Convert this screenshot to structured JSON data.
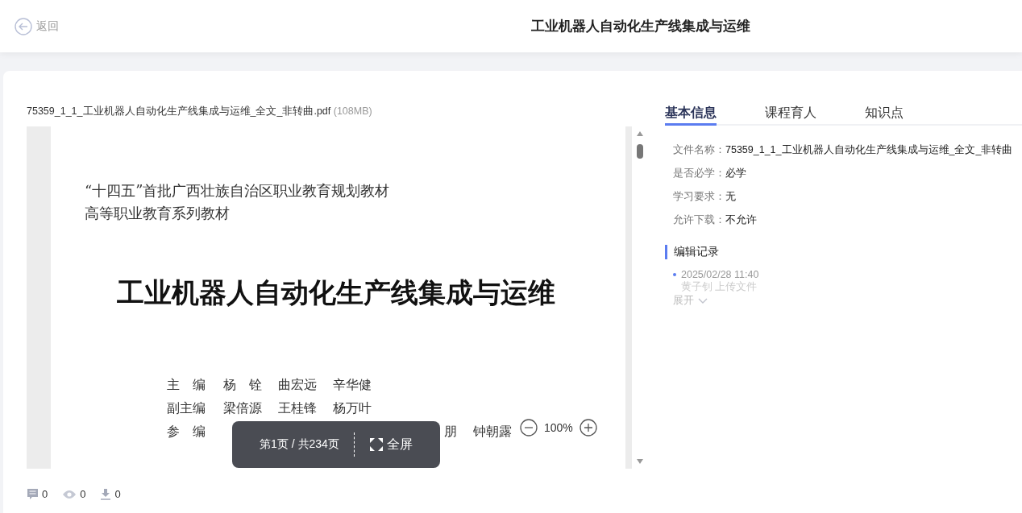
{
  "header": {
    "back_label": "返回",
    "title": "工业机器人自动化生产线集成与运维"
  },
  "file": {
    "name": "75359_1_1_工业机器人自动化生产线集成与运维_全文_非转曲.pdf",
    "size": "(108MB)"
  },
  "document_page": {
    "series_lines": [
      "“十四五”首批广西壮族自治区职业教育规划教材",
      "高等职业教育系列教材"
    ],
    "book_title": "工业机器人自动化生产线集成与运维",
    "credits": [
      {
        "role": "主　编",
        "names": [
          "杨　铨",
          "曲宏远",
          "辛华健"
        ]
      },
      {
        "role": "副主编",
        "names": [
          "梁倍源",
          "王桂锋",
          "杨万叶"
        ]
      },
      {
        "role": "参　编",
        "names": [
          "朋",
          "钟朝露"
        ]
      }
    ]
  },
  "viewer": {
    "page_indicator": "第1页 / 共234页",
    "fullscreen_label": "全屏",
    "zoom": "100%"
  },
  "tabs": [
    {
      "label": "基本信息",
      "selected": true
    },
    {
      "label": "课程育人",
      "selected": false
    },
    {
      "label": "知识点",
      "selected": false
    }
  ],
  "info": [
    {
      "label": "文件名称：",
      "value": "75359_1_1_工业机器人自动化生产线集成与运维_全文_非转曲"
    },
    {
      "label": "是否必学：",
      "value": "必学"
    },
    {
      "label": "学习要求：",
      "value": "无"
    },
    {
      "label": "允许下载：",
      "value": "不允许"
    }
  ],
  "edit_log": {
    "title": "编辑记录",
    "entries": [
      {
        "time": "2025/02/28 11:40",
        "text": "黄子钊 上传文件"
      }
    ],
    "expand_label": "展开"
  },
  "stats": {
    "comments": "0",
    "views": "0",
    "downloads": "0"
  }
}
